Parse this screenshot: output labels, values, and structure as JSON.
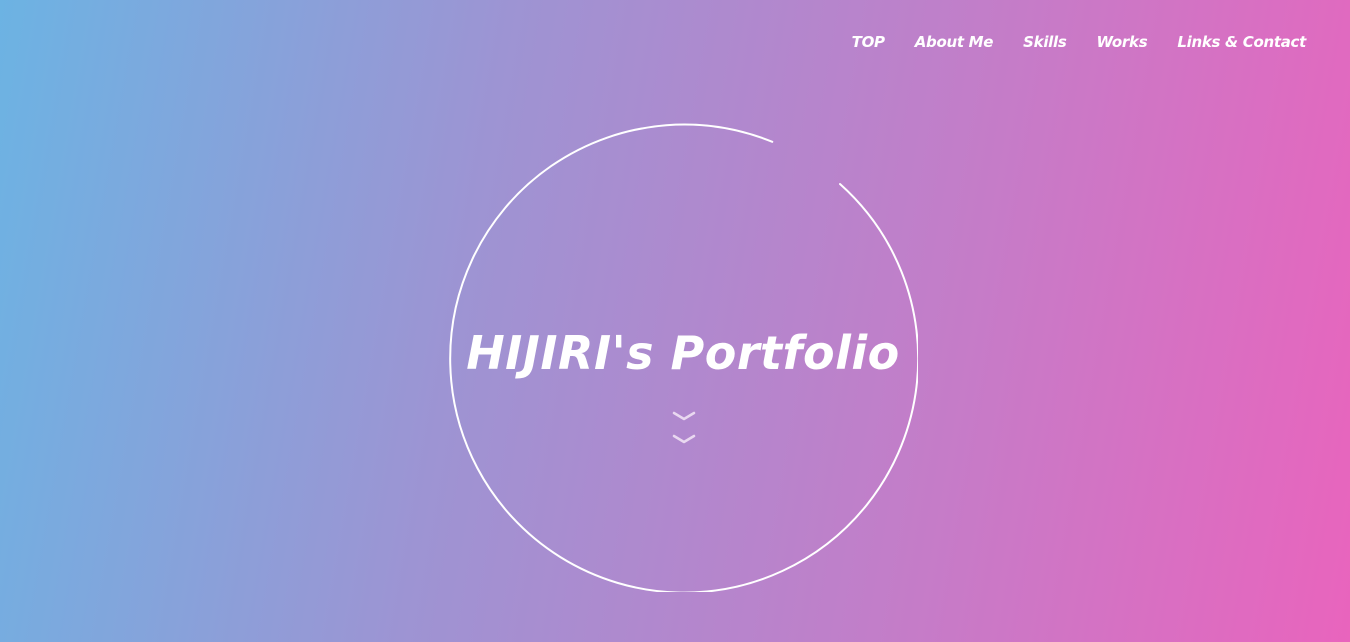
{
  "nav": {
    "items": [
      {
        "label": "TOP"
      },
      {
        "label": "About Me"
      },
      {
        "label": "Skills"
      },
      {
        "label": "Works"
      },
      {
        "label": "Links & Contact"
      }
    ]
  },
  "hero": {
    "title": "HIJIRI's Portfolio",
    "scroll_icon": "double-chevron-down-icon"
  },
  "colors": {
    "gradient_start": "#6cb3e3",
    "gradient_mid": "#c57cc8",
    "gradient_end": "#e964bd",
    "text": "#ffffff"
  }
}
